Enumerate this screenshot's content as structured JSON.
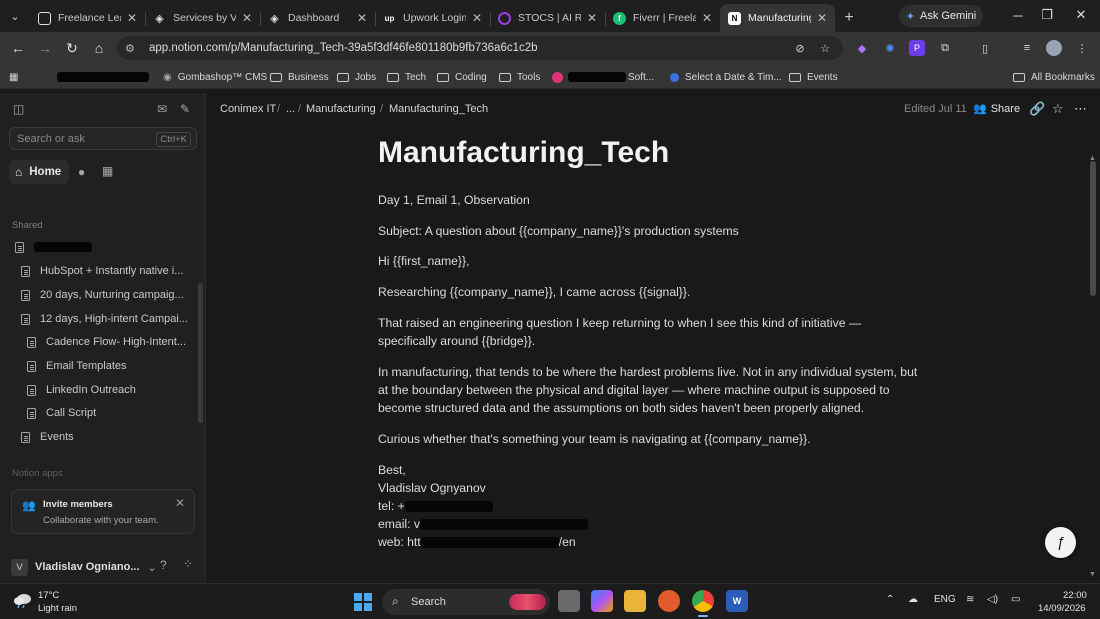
{
  "browser": {
    "tabs": [
      {
        "title": "Freelance Lead",
        "favicon": "doc-icon",
        "color": "#e0e0e0"
      },
      {
        "title": "Services by Vla",
        "favicon": "diamond-icon",
        "color": "#e0e0e0"
      },
      {
        "title": "Dashboard",
        "favicon": "diamond-icon",
        "color": "#e0e0e0"
      },
      {
        "title": "Upwork Login",
        "favicon": "upwork-icon",
        "color": "#14a800"
      },
      {
        "title": "STOCS | AI Rec",
        "favicon": "circle-icon",
        "color": "#9b3ce0"
      },
      {
        "title": "Fiverr | Freelanc",
        "favicon": "fiverr-icon",
        "color": "#1dbf73"
      },
      {
        "title": "Manufacturing",
        "favicon": "notion-icon",
        "color": "#ffffff"
      }
    ],
    "gemini_label": "Ask Gemini",
    "url": "app.notion.com/p/Manufacturing_Tech-39a5f3df46fe801180b9fb736a6c1c2b",
    "bookmarks": [
      "Gombashop™ CMS",
      "Business",
      "Jobs",
      "Tech",
      "Coding",
      "Tools",
      "Soft...",
      "Select a Date & Tim...",
      "Events"
    ],
    "all_bookmarks": "All Bookmarks"
  },
  "sidebar": {
    "search_placeholder": "Search or ask",
    "search_shortcut": "Ctrl+K",
    "home": "Home",
    "shared_label": "Shared",
    "items": [
      "HubSpot + Instantly native i...",
      "20 days, Nurturing campaig...",
      "12 days, High-intent Campai...",
      "Cadence Flow- High-Intent...",
      "Email Templates",
      "LinkedIn Outreach",
      "Call Script",
      "Events"
    ],
    "notion_apps": "Notion apps",
    "invite_title": "Invite members",
    "invite_subtitle": "Collaborate with your team.",
    "user_initial": "V",
    "user_name": "Vladislav Ogniano..."
  },
  "page": {
    "breadcrumbs": [
      "Conimex IT",
      "...",
      "Manufacturing",
      "Manufacturing_Tech"
    ],
    "edited": "Edited Jul 11",
    "share": "Share",
    "title": "Manufacturing_Tech",
    "paragraphs": [
      "Day 1, Email 1, Observation",
      "Subject: A question about {{company_name}}'s production systems",
      "Hi {{first_name}},",
      "Researching {{company_name}}, I came across {{signal}}.",
      "That raised an engineering question I keep returning to when I see this kind of initiative — specifically around {{bridge}}.",
      "In manufacturing, that tends to be where the hardest problems live. Not in any individual system, but at the boundary between the physical and digital layer — where machine output is supposed to become structured data and the assumptions on both sides haven't been properly aligned.",
      "Curious whether that's something your team is navigating at {{company_name}}."
    ],
    "signoff": "Best,",
    "signature_name": "Vladislav Ognyanov",
    "tel_label": "tel: +",
    "email_label": "email: v",
    "web_label": "web: htt",
    "web_suffix": "/en"
  },
  "taskbar": {
    "temperature": "17°C",
    "weather": "Light rain",
    "search": "Search",
    "language": "ENG",
    "time": "22:00",
    "date": "14/09/2026"
  }
}
